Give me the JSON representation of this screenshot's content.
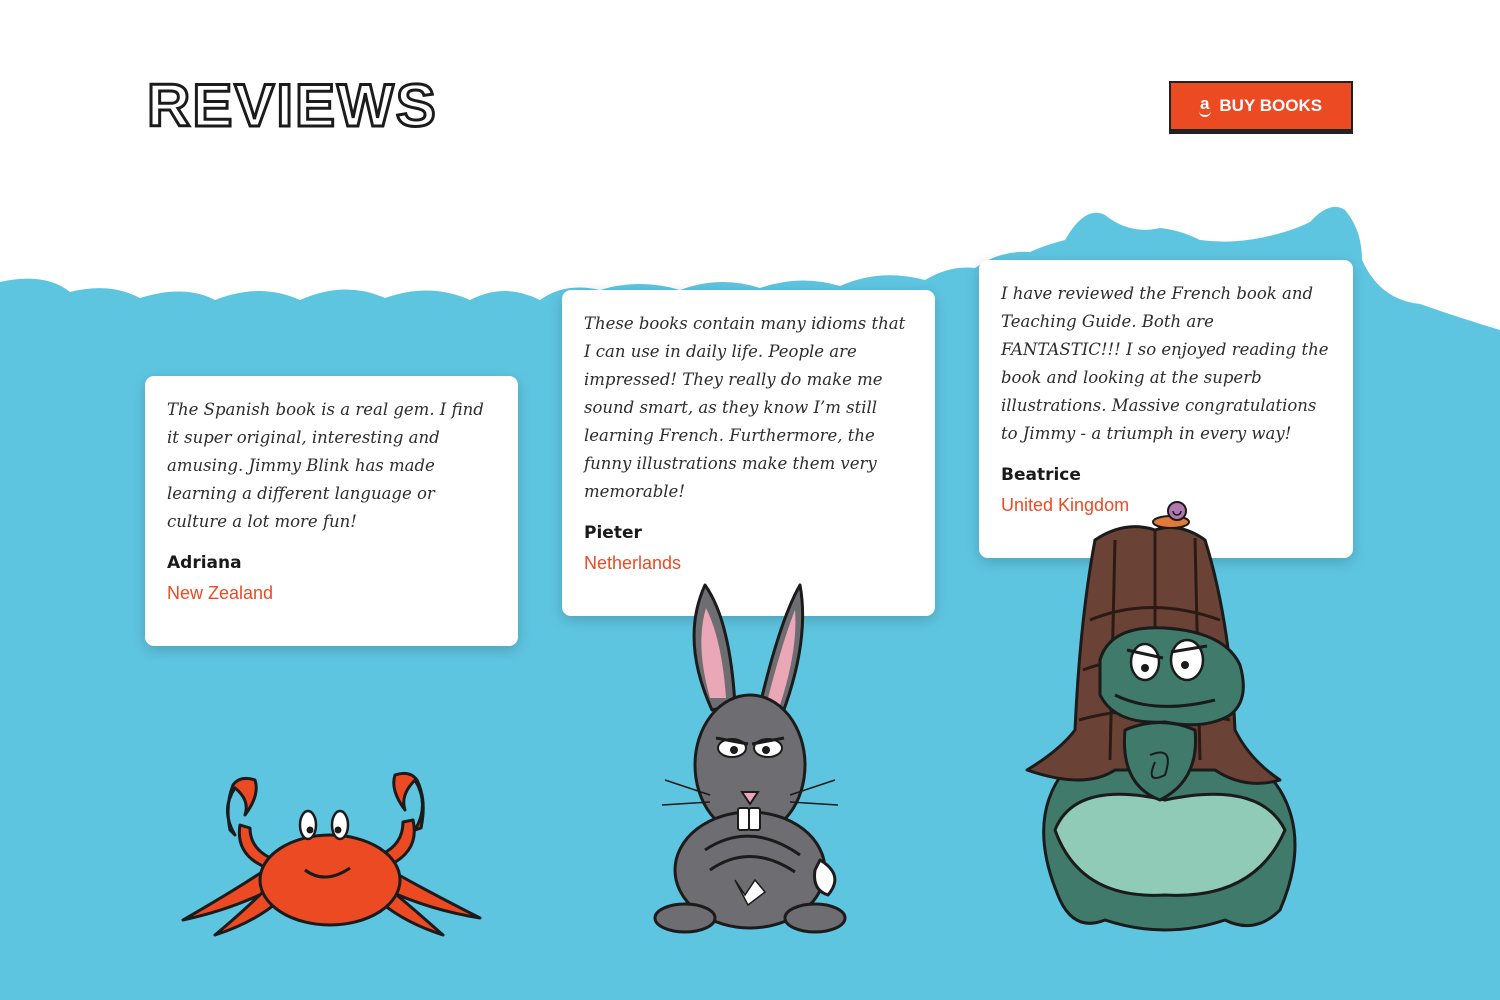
{
  "header": {
    "title": "REVIEWS",
    "buy_button": {
      "icon": "a",
      "label": "BUY BOOKS"
    }
  },
  "colors": {
    "sky": "#5ec5e1",
    "accent": "#eb4a23",
    "card": "#ffffff",
    "heading": "#1b1b1b"
  },
  "reviews": [
    {
      "quote": "The Spanish book is a real gem. I find it super original, interesting and amusing. Jimmy Blink has made learning a different language or culture a lot more fun!",
      "name": "Adriana",
      "country": "New Zealand",
      "illustration": "crab-illustration"
    },
    {
      "quote": "These books contain many idioms that I can use in daily life. People are impressed! They really do make me sound smart, as they know I’m still learning French. Furthermore, the funny illustrations make them very memorable!",
      "name": "Pieter",
      "country": "Netherlands",
      "illustration": "rabbit-illustration"
    },
    {
      "quote": "I have reviewed the French book and Teaching Guide. Both are FANTASTIC!!! I so enjoyed reading the book and looking at the superb illustrations. Massive congratulations to Jimmy - a triumph in every way!",
      "name": "Beatrice",
      "country": "United Kingdom",
      "illustration": "turtle-illustration"
    }
  ]
}
